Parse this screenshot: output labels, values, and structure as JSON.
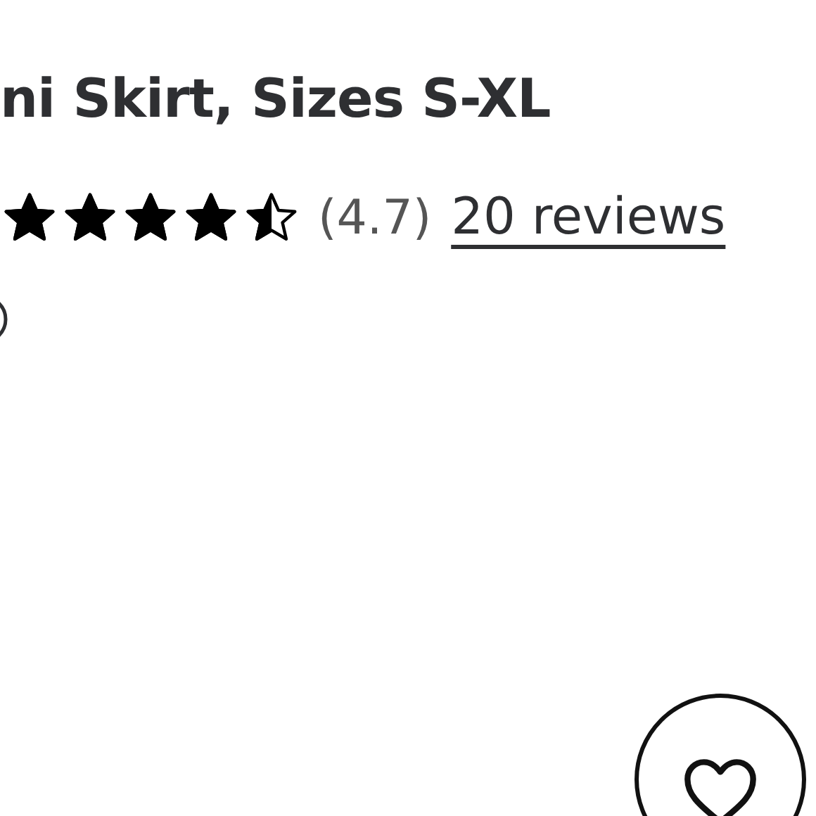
{
  "product": {
    "title": "ni Skirt, Sizes S-XL"
  },
  "rating": {
    "stars": 4.5,
    "score": "(4.7)",
    "reviews_link": "20 reviews"
  },
  "favorite_button": {
    "kind": "heart"
  }
}
